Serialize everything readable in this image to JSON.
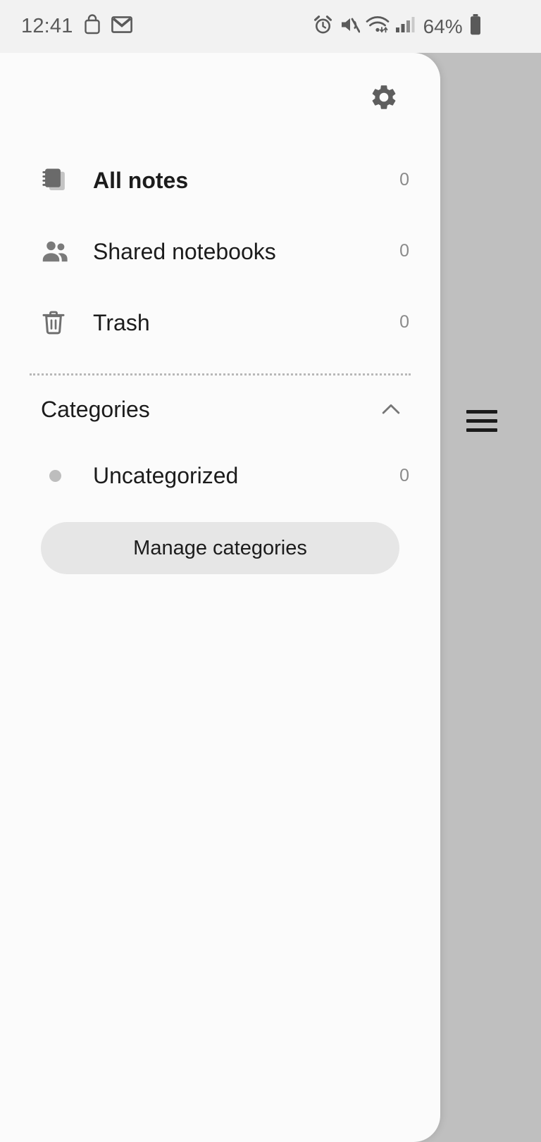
{
  "status_bar": {
    "time": "12:41",
    "battery_percent": "64%",
    "left_icons": [
      "shopping-bag-icon",
      "gmail-icon"
    ],
    "right_icons": [
      "alarm-icon",
      "mute-icon",
      "wifi-icon",
      "signal-icon",
      "battery-icon"
    ]
  },
  "scrim": {
    "menu_icon": "hamburger-menu-icon",
    "color": "#bfbfbf"
  },
  "drawer": {
    "settings_icon": "gear-icon",
    "nav_items": [
      {
        "icon": "notes-stack-icon",
        "label": "All notes",
        "count": "0",
        "selected": true
      },
      {
        "icon": "people-group-icon",
        "label": "Shared notebooks",
        "count": "0",
        "selected": false
      },
      {
        "icon": "trash-icon",
        "label": "Trash",
        "count": "0",
        "selected": false
      }
    ],
    "categories": {
      "title": "Categories",
      "collapse_icon": "chevron-up-icon",
      "expanded": true,
      "items": [
        {
          "label": "Uncategorized",
          "count": "0",
          "dot_color": "#bdbdbd"
        }
      ],
      "manage_label": "Manage categories"
    }
  }
}
